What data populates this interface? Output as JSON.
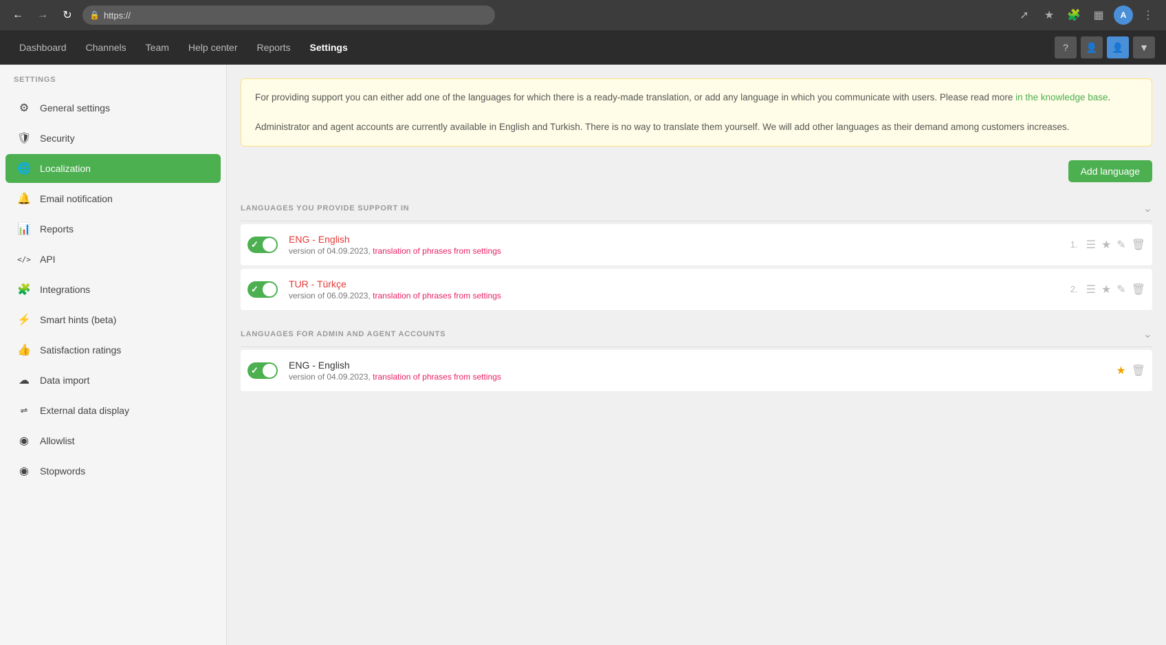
{
  "browser": {
    "url": "https://",
    "back": "←",
    "forward": "→",
    "reload": "↻"
  },
  "app_nav": {
    "items": [
      {
        "label": "Dashboard",
        "active": false
      },
      {
        "label": "Channels",
        "active": false
      },
      {
        "label": "Team",
        "active": false
      },
      {
        "label": "Help center",
        "active": false
      },
      {
        "label": "Reports",
        "active": false
      },
      {
        "label": "Settings",
        "active": true
      }
    ]
  },
  "sidebar": {
    "header": "SETTINGS",
    "items": [
      {
        "label": "General settings",
        "icon": "⚙",
        "active": false
      },
      {
        "label": "Security",
        "icon": "🛡",
        "active": false
      },
      {
        "label": "Localization",
        "icon": "🌐",
        "active": true
      },
      {
        "label": "Email notification",
        "icon": "🔔",
        "active": false
      },
      {
        "label": "Reports",
        "icon": "📊",
        "active": false
      },
      {
        "label": "API",
        "icon": "</>",
        "active": false
      },
      {
        "label": "Integrations",
        "icon": "🧩",
        "active": false
      },
      {
        "label": "Smart hints (beta)",
        "icon": "⚡",
        "active": false
      },
      {
        "label": "Satisfaction ratings",
        "icon": "👍",
        "active": false
      },
      {
        "label": "Data import",
        "icon": "☁",
        "active": false
      },
      {
        "label": "External data display",
        "icon": "⇌",
        "active": false
      },
      {
        "label": "Allowlist",
        "icon": "◉",
        "active": false
      },
      {
        "label": "Stopwords",
        "icon": "◉",
        "active": false
      }
    ]
  },
  "info_box": {
    "line1": "For providing support you can either add one of the languages for which there is a ready-made translation, or add any language in which you communicate with users.",
    "line1_prefix": "For providing support you can either add one of the languages for which there is a ready-made translation, or add any language in which you communicate with users. Please read more ",
    "link_text": "in the knowledge base",
    "line2": "Administrator and agent accounts are currently available in English and Turkish. There is no way to translate them yourself. We will add other languages as their demand among customers increases."
  },
  "add_language_btn": "Add language",
  "sections": {
    "support": {
      "title": "LANGUAGES YOU PROVIDE SUPPORT IN",
      "languages": [
        {
          "code": "ENG - English",
          "version": "version of 04.09.2023,",
          "translation_link": "translation of phrases from settings",
          "num": "1.",
          "enabled": true,
          "color": "red"
        },
        {
          "code": "TUR - Türkçe",
          "version": "version of 06.09.2023,",
          "translation_link": "translation of phrases from settings",
          "num": "2.",
          "enabled": true,
          "color": "red"
        }
      ]
    },
    "admin": {
      "title": "LANGUAGES FOR ADMIN AND AGENT ACCOUNTS",
      "languages": [
        {
          "code": "ENG - English",
          "version": "version of 04.09.2023,",
          "translation_link": "translation of phrases from settings",
          "num": "",
          "enabled": true,
          "color": "dark"
        }
      ]
    }
  }
}
